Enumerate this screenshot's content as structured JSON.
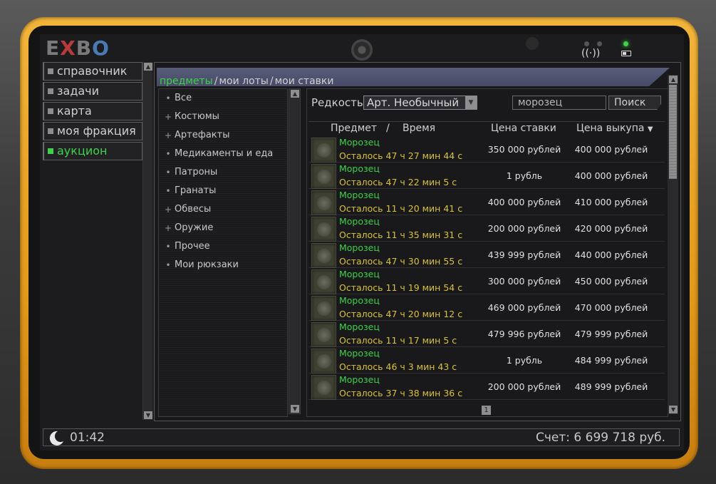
{
  "brand": {
    "logo_prefix": "E",
    "logo_x": "X",
    "logo_b": "B",
    "logo_o": "O"
  },
  "nav": {
    "items": [
      {
        "label": "справочник",
        "active": false
      },
      {
        "label": "задачи",
        "active": false
      },
      {
        "label": "карта",
        "active": false
      },
      {
        "label": "моя фракция",
        "active": false
      },
      {
        "label": "аукцион",
        "active": true
      }
    ]
  },
  "breadcrumb": {
    "tab1": "предметы",
    "sep": "/",
    "tab2": "мои лоты",
    "tab3": "мои ставки"
  },
  "categories": [
    {
      "bullet": "•",
      "label": "Все"
    },
    {
      "bullet": "+",
      "label": "Костюмы"
    },
    {
      "bullet": "+",
      "label": "Артефакты"
    },
    {
      "bullet": "•",
      "label": "Медикаменты и еда"
    },
    {
      "bullet": "•",
      "label": "Патроны"
    },
    {
      "bullet": "•",
      "label": "Гранаты"
    },
    {
      "bullet": "+",
      "label": "Обвесы"
    },
    {
      "bullet": "+",
      "label": "Оружие"
    },
    {
      "bullet": "•",
      "label": "Прочее"
    },
    {
      "bullet": "•",
      "label": "Мои рюкзаки"
    }
  ],
  "filter": {
    "rarity_label": "Редкость",
    "rarity_value": "Арт. Необычный",
    "search_value": "морозец",
    "search_button": "Поиск"
  },
  "table": {
    "headers": {
      "item": "Предмет",
      "slash": "/",
      "time": "Время",
      "bid": "Цена ставки",
      "buyout": "Цена выкупа",
      "sort_arrow": "▼"
    },
    "rows": [
      {
        "name": "Морозец",
        "time": "Осталось 47 ч 27 мин 44 с",
        "bid": "350 000 рублей",
        "buyout": "400 000 рублей"
      },
      {
        "name": "Морозец",
        "time": "Осталось 47 ч 22 мин 5 с",
        "bid": "1 рубль",
        "buyout": "400 000 рублей"
      },
      {
        "name": "Морозец",
        "time": "Осталось 11 ч 20 мин 41 с",
        "bid": "400 000 рублей",
        "buyout": "410 000 рублей"
      },
      {
        "name": "Морозец",
        "time": "Осталось 11 ч 35 мин 31 с",
        "bid": "200 000 рублей",
        "buyout": "420 000 рублей"
      },
      {
        "name": "Морозец",
        "time": "Осталось 47 ч 30 мин 55 с",
        "bid": "439 999 рублей",
        "buyout": "440 000 рублей"
      },
      {
        "name": "Морозец",
        "time": "Осталось 11 ч 19 мин 54 с",
        "bid": "300 000 рублей",
        "buyout": "450 000 рублей"
      },
      {
        "name": "Морозец",
        "time": "Осталось 47 ч 20 мин 12 с",
        "bid": "469 000 рублей",
        "buyout": "470 000 рублей"
      },
      {
        "name": "Морозец",
        "time": "Осталось 11 ч 17 мин 5 с",
        "bid": "479 996 рублей",
        "buyout": "479 999 рублей"
      },
      {
        "name": "Морозец",
        "time": "Осталось 46 ч 3 мин 43 с",
        "bid": "1 рубль",
        "buyout": "484 999 рублей"
      },
      {
        "name": "Морозец",
        "time": "Осталось 37 ч 38 мин 36 с",
        "bid": "200 000 рублей",
        "buyout": "489 999 рублей"
      }
    ]
  },
  "pagination": {
    "current": "1"
  },
  "status": {
    "time": "01:42",
    "balance": "Счет: 6 699 718 руб."
  },
  "colors": {
    "accent_green": "#3fd14a",
    "timer_yellow": "#d9c13a",
    "frame_orange": "#e49a1a",
    "logo_red": "#b83a3a",
    "logo_blue": "#4a7ab5"
  },
  "icons": {
    "moon": "moon-icon",
    "wifi": "wifi-icon",
    "battery": "battery-icon",
    "sort": "sort-arrow-icon",
    "dropdown": "chevron-down-icon"
  }
}
